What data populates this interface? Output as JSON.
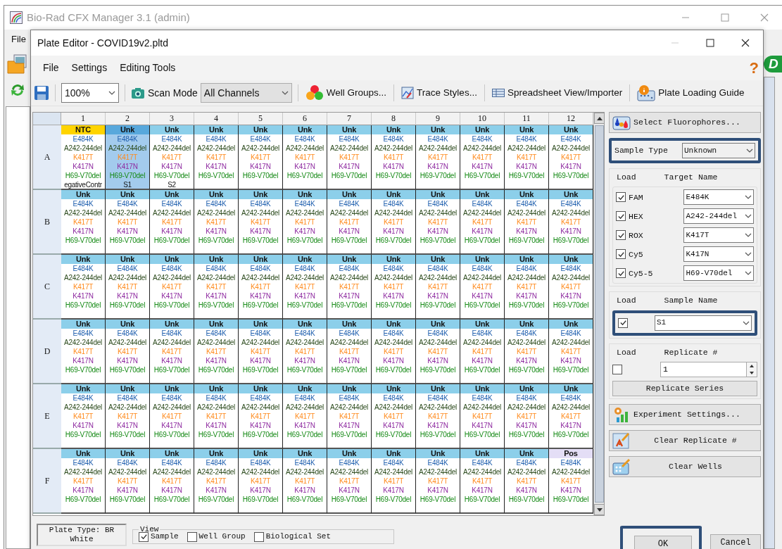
{
  "main_window": {
    "title": "Bio-Rad CFX Manager 3.1 (admin)",
    "menu": [
      "File"
    ],
    "logo_text": "D"
  },
  "dialog": {
    "title": "Plate Editor - COVID19v2.pltd",
    "menu": [
      "File",
      "Settings",
      "Editing Tools"
    ],
    "help": "?",
    "toolbar": {
      "zoom": "100%",
      "scan_mode_label": "Scan Mode",
      "scan_mode": "All Channels",
      "buttons": [
        {
          "kind": "well-groups",
          "label": "Well Groups..."
        },
        {
          "kind": "trace-styles",
          "label": "Trace Styles..."
        },
        {
          "kind": "spreadsheet",
          "label": "Spreadsheet View/Importer"
        },
        {
          "kind": "loading-guide",
          "label": "Plate Loading Guide"
        }
      ]
    }
  },
  "plate": {
    "columns": [
      "1",
      "2",
      "3",
      "4",
      "5",
      "6",
      "7",
      "8",
      "9",
      "10",
      "11",
      "12"
    ],
    "rows": [
      {
        "label": "A",
        "wells": [
          {
            "kind": "ntc",
            "type": "NTC",
            "targets": [
              "E484K",
              "A242-244del",
              "K417T",
              "K417N",
              "H69-V70del"
            ],
            "sample": "egativeContr",
            "selected": false
          },
          {
            "kind": "unknown",
            "type": "Unk",
            "targets": [
              "E484K",
              "A242-244del",
              "K417T",
              "K417N",
              "H69-V70del"
            ],
            "sample": "S1",
            "selected": true
          },
          {
            "kind": "unknown",
            "type": "Unk",
            "targets": [
              "E484K",
              "A242-244del",
              "K417T",
              "K417N",
              "H69-V70del"
            ],
            "sample": "S2",
            "selected": false
          },
          {
            "kind": "unknown",
            "type": "Unk",
            "targets": [
              "E484K",
              "A242-244del",
              "K417T",
              "K417N",
              "H69-V70del"
            ],
            "selected": false
          },
          {
            "kind": "unknown",
            "type": "Unk",
            "targets": [
              "E484K",
              "A242-244del",
              "K417T",
              "K417N",
              "H69-V70del"
            ],
            "selected": false
          },
          {
            "kind": "unknown",
            "type": "Unk",
            "targets": [
              "E484K",
              "A242-244del",
              "K417T",
              "K417N",
              "H69-V70del"
            ],
            "selected": false
          },
          {
            "kind": "unknown",
            "type": "Unk",
            "targets": [
              "E484K",
              "A242-244del",
              "K417T",
              "K417N",
              "H69-V70del"
            ],
            "selected": false
          },
          {
            "kind": "unknown",
            "type": "Unk",
            "targets": [
              "E484K",
              "A242-244del",
              "K417T",
              "K417N",
              "H69-V70del"
            ],
            "selected": false
          },
          {
            "kind": "unknown",
            "type": "Unk",
            "targets": [
              "E484K",
              "A242-244del",
              "K417T",
              "K417N",
              "H69-V70del"
            ],
            "selected": false
          },
          {
            "kind": "unknown",
            "type": "Unk",
            "targets": [
              "E484K",
              "A242-244del",
              "K417T",
              "K417N",
              "H69-V70del"
            ],
            "selected": false
          },
          {
            "kind": "unknown",
            "type": "Unk",
            "targets": [
              "E484K",
              "A242-244del",
              "K417T",
              "K417N",
              "H69-V70del"
            ],
            "selected": false
          },
          {
            "kind": "unknown",
            "type": "Unk",
            "targets": [
              "E484K",
              "A242-244del",
              "K417T",
              "K417N",
              "H69-V70del"
            ],
            "selected": false
          }
        ]
      },
      {
        "label": "B",
        "wells": [
          {
            "kind": "unknown",
            "type": "Unk",
            "targets": [
              "E484K",
              "A242-244del",
              "K417T",
              "K417N",
              "H69-V70del"
            ],
            "selected": false
          },
          {
            "kind": "unknown",
            "type": "Unk",
            "targets": [
              "E484K",
              "A242-244del",
              "K417T",
              "K417N",
              "H69-V70del"
            ],
            "selected": false
          },
          {
            "kind": "unknown",
            "type": "Unk",
            "targets": [
              "E484K",
              "A242-244del",
              "K417T",
              "K417N",
              "H69-V70del"
            ],
            "selected": false
          },
          {
            "kind": "unknown",
            "type": "Unk",
            "targets": [
              "E484K",
              "A242-244del",
              "K417T",
              "K417N",
              "H69-V70del"
            ],
            "selected": false
          },
          {
            "kind": "unknown",
            "type": "Unk",
            "targets": [
              "E484K",
              "A242-244del",
              "K417T",
              "K417N",
              "H69-V70del"
            ],
            "selected": false
          },
          {
            "kind": "unknown",
            "type": "Unk",
            "targets": [
              "E484K",
              "A242-244del",
              "K417T",
              "K417N",
              "H69-V70del"
            ],
            "selected": false
          },
          {
            "kind": "unknown",
            "type": "Unk",
            "targets": [
              "E484K",
              "A242-244del",
              "K417T",
              "K417N",
              "H69-V70del"
            ],
            "selected": false
          },
          {
            "kind": "unknown",
            "type": "Unk",
            "targets": [
              "E484K",
              "A242-244del",
              "K417T",
              "K417N",
              "H69-V70del"
            ],
            "selected": false
          },
          {
            "kind": "unknown",
            "type": "Unk",
            "targets": [
              "E484K",
              "A242-244del",
              "K417T",
              "K417N",
              "H69-V70del"
            ],
            "selected": false
          },
          {
            "kind": "unknown",
            "type": "Unk",
            "targets": [
              "E484K",
              "A242-244del",
              "K417T",
              "K417N",
              "H69-V70del"
            ],
            "selected": false
          },
          {
            "kind": "unknown",
            "type": "Unk",
            "targets": [
              "E484K",
              "A242-244del",
              "K417T",
              "K417N",
              "H69-V70del"
            ],
            "selected": false
          },
          {
            "kind": "unknown",
            "type": "Unk",
            "targets": [
              "E484K",
              "A242-244del",
              "K417T",
              "K417N",
              "H69-V70del"
            ],
            "selected": false
          }
        ]
      },
      {
        "label": "C",
        "wells": [
          {
            "kind": "unknown",
            "type": "Unk",
            "targets": [
              "E484K",
              "A242-244del",
              "K417T",
              "K417N",
              "H69-V70del"
            ],
            "selected": false
          },
          {
            "kind": "unknown",
            "type": "Unk",
            "targets": [
              "E484K",
              "A242-244del",
              "K417T",
              "K417N",
              "H69-V70del"
            ],
            "selected": false
          },
          {
            "kind": "unknown",
            "type": "Unk",
            "targets": [
              "E484K",
              "A242-244del",
              "K417T",
              "K417N",
              "H69-V70del"
            ],
            "selected": false
          },
          {
            "kind": "unknown",
            "type": "Unk",
            "targets": [
              "E484K",
              "A242-244del",
              "K417T",
              "K417N",
              "H69-V70del"
            ],
            "selected": false
          },
          {
            "kind": "unknown",
            "type": "Unk",
            "targets": [
              "E484K",
              "A242-244del",
              "K417T",
              "K417N",
              "H69-V70del"
            ],
            "selected": false
          },
          {
            "kind": "unknown",
            "type": "Unk",
            "targets": [
              "E484K",
              "A242-244del",
              "K417T",
              "K417N",
              "H69-V70del"
            ],
            "selected": false
          },
          {
            "kind": "unknown",
            "type": "Unk",
            "targets": [
              "E484K",
              "A242-244del",
              "K417T",
              "K417N",
              "H69-V70del"
            ],
            "selected": false
          },
          {
            "kind": "unknown",
            "type": "Unk",
            "targets": [
              "E484K",
              "A242-244del",
              "K417T",
              "K417N",
              "H69-V70del"
            ],
            "selected": false
          },
          {
            "kind": "unknown",
            "type": "Unk",
            "targets": [
              "E484K",
              "A242-244del",
              "K417T",
              "K417N",
              "H69-V70del"
            ],
            "selected": false
          },
          {
            "kind": "unknown",
            "type": "Unk",
            "targets": [
              "E484K",
              "A242-244del",
              "K417T",
              "K417N",
              "H69-V70del"
            ],
            "selected": false
          },
          {
            "kind": "unknown",
            "type": "Unk",
            "targets": [
              "E484K",
              "A242-244del",
              "K417T",
              "K417N",
              "H69-V70del"
            ],
            "selected": false
          },
          {
            "kind": "unknown",
            "type": "Unk",
            "targets": [
              "E484K",
              "A242-244del",
              "K417T",
              "K417N",
              "H69-V70del"
            ],
            "selected": false
          }
        ]
      },
      {
        "label": "D",
        "wells": [
          {
            "kind": "unknown",
            "type": "Unk",
            "targets": [
              "E484K",
              "A242-244del",
              "K417T",
              "K417N",
              "H69-V70del"
            ],
            "selected": false
          },
          {
            "kind": "unknown",
            "type": "Unk",
            "targets": [
              "E484K",
              "A242-244del",
              "K417T",
              "K417N",
              "H69-V70del"
            ],
            "selected": false
          },
          {
            "kind": "unknown",
            "type": "Unk",
            "targets": [
              "E484K",
              "A242-244del",
              "K417T",
              "K417N",
              "H69-V70del"
            ],
            "selected": false
          },
          {
            "kind": "unknown",
            "type": "Unk",
            "targets": [
              "E484K",
              "A242-244del",
              "K417T",
              "K417N",
              "H69-V70del"
            ],
            "selected": false
          },
          {
            "kind": "unknown",
            "type": "Unk",
            "targets": [
              "E484K",
              "A242-244del",
              "K417T",
              "K417N",
              "H69-V70del"
            ],
            "selected": false
          },
          {
            "kind": "unknown",
            "type": "Unk",
            "targets": [
              "E484K",
              "A242-244del",
              "K417T",
              "K417N",
              "H69-V70del"
            ],
            "selected": false
          },
          {
            "kind": "unknown",
            "type": "Unk",
            "targets": [
              "E484K",
              "A242-244del",
              "K417T",
              "K417N",
              "H69-V70del"
            ],
            "selected": false
          },
          {
            "kind": "unknown",
            "type": "Unk",
            "targets": [
              "E484K",
              "A242-244del",
              "K417T",
              "K417N",
              "H69-V70del"
            ],
            "selected": false
          },
          {
            "kind": "unknown",
            "type": "Unk",
            "targets": [
              "E484K",
              "A242-244del",
              "K417T",
              "K417N",
              "H69-V70del"
            ],
            "selected": false
          },
          {
            "kind": "unknown",
            "type": "Unk",
            "targets": [
              "E484K",
              "A242-244del",
              "K417T",
              "K417N",
              "H69-V70del"
            ],
            "selected": false
          },
          {
            "kind": "unknown",
            "type": "Unk",
            "targets": [
              "E484K",
              "A242-244del",
              "K417T",
              "K417N",
              "H69-V70del"
            ],
            "selected": false
          },
          {
            "kind": "unknown",
            "type": "Unk",
            "targets": [
              "E484K",
              "A242-244del",
              "K417T",
              "K417N",
              "H69-V70del"
            ],
            "selected": false
          }
        ]
      },
      {
        "label": "E",
        "wells": [
          {
            "kind": "unknown",
            "type": "Unk",
            "targets": [
              "E484K",
              "A242-244del",
              "K417T",
              "K417N",
              "H69-V70del"
            ],
            "selected": false
          },
          {
            "kind": "unknown",
            "type": "Unk",
            "targets": [
              "E484K",
              "A242-244del",
              "K417T",
              "K417N",
              "H69-V70del"
            ],
            "selected": false
          },
          {
            "kind": "unknown",
            "type": "Unk",
            "targets": [
              "E484K",
              "A242-244del",
              "K417T",
              "K417N",
              "H69-V70del"
            ],
            "selected": false
          },
          {
            "kind": "unknown",
            "type": "Unk",
            "targets": [
              "E484K",
              "A242-244del",
              "K417T",
              "K417N",
              "H69-V70del"
            ],
            "selected": false
          },
          {
            "kind": "unknown",
            "type": "Unk",
            "targets": [
              "E484K",
              "A242-244del",
              "K417T",
              "K417N",
              "H69-V70del"
            ],
            "selected": false
          },
          {
            "kind": "unknown",
            "type": "Unk",
            "targets": [
              "E484K",
              "A242-244del",
              "K417T",
              "K417N",
              "H69-V70del"
            ],
            "selected": false
          },
          {
            "kind": "unknown",
            "type": "Unk",
            "targets": [
              "E484K",
              "A242-244del",
              "K417T",
              "K417N",
              "H69-V70del"
            ],
            "selected": false
          },
          {
            "kind": "unknown",
            "type": "Unk",
            "targets": [
              "E484K",
              "A242-244del",
              "K417T",
              "K417N",
              "H69-V70del"
            ],
            "selected": false
          },
          {
            "kind": "unknown",
            "type": "Unk",
            "targets": [
              "E484K",
              "A242-244del",
              "K417T",
              "K417N",
              "H69-V70del"
            ],
            "selected": false
          },
          {
            "kind": "unknown",
            "type": "Unk",
            "targets": [
              "E484K",
              "A242-244del",
              "K417T",
              "K417N",
              "H69-V70del"
            ],
            "selected": false
          },
          {
            "kind": "unknown",
            "type": "Unk",
            "targets": [
              "E484K",
              "A242-244del",
              "K417T",
              "K417N",
              "H69-V70del"
            ],
            "selected": false
          },
          {
            "kind": "unknown",
            "type": "Unk",
            "targets": [
              "E484K",
              "A242-244del",
              "K417T",
              "K417N",
              "H69-V70del"
            ],
            "selected": false
          }
        ]
      },
      {
        "label": "F",
        "wells": [
          {
            "kind": "unknown",
            "type": "Unk",
            "targets": [
              "E484K",
              "A242-244del",
              "K417T",
              "K417N",
              "H69-V70del"
            ],
            "selected": false
          },
          {
            "kind": "unknown",
            "type": "Unk",
            "targets": [
              "E484K",
              "A242-244del",
              "K417T",
              "K417N",
              "H69-V70del"
            ],
            "selected": false
          },
          {
            "kind": "unknown",
            "type": "Unk",
            "targets": [
              "E484K",
              "A242-244del",
              "K417T",
              "K417N",
              "H69-V70del"
            ],
            "selected": false
          },
          {
            "kind": "unknown",
            "type": "Unk",
            "targets": [
              "E484K",
              "A242-244del",
              "K417T",
              "K417N",
              "H69-V70del"
            ],
            "selected": false
          },
          {
            "kind": "unknown",
            "type": "Unk",
            "targets": [
              "E484K",
              "A242-244del",
              "K417T",
              "K417N",
              "H69-V70del"
            ],
            "selected": false
          },
          {
            "kind": "unknown",
            "type": "Unk",
            "targets": [
              "E484K",
              "A242-244del",
              "K417T",
              "K417N",
              "H69-V70del"
            ],
            "selected": false
          },
          {
            "kind": "unknown",
            "type": "Unk",
            "targets": [
              "E484K",
              "A242-244del",
              "K417T",
              "K417N",
              "H69-V70del"
            ],
            "selected": false
          },
          {
            "kind": "unknown",
            "type": "Unk",
            "targets": [
              "E484K",
              "A242-244del",
              "K417T",
              "K417N",
              "H69-V70del"
            ],
            "selected": false
          },
          {
            "kind": "unknown",
            "type": "Unk",
            "targets": [
              "E484K",
              "A242-244del",
              "K417T",
              "K417N",
              "H69-V70del"
            ],
            "selected": false
          },
          {
            "kind": "unknown",
            "type": "Unk",
            "targets": [
              "E484K",
              "A242-244del",
              "K417T",
              "K417N",
              "H69-V70del"
            ],
            "selected": false
          },
          {
            "kind": "unknown",
            "type": "Unk",
            "targets": [
              "E484K",
              "A242-244del",
              "K417T",
              "K417N",
              "H69-V70del"
            ],
            "selected": false
          },
          {
            "kind": "positive",
            "type": "Pos",
            "targets": [
              "E484K",
              "A242-244del",
              "K417T",
              "K417N",
              "H69-V70del"
            ],
            "selected": false
          }
        ]
      }
    ]
  },
  "panel": {
    "select_fluorophores": "Select Fluorophores...",
    "sample_type_label": "Sample Type",
    "sample_type": "Unknown",
    "target_headers": [
      "Load",
      "Target Name"
    ],
    "targets": [
      {
        "fluor": "FAM",
        "checked": true,
        "target": "E484K",
        "color": "#1f5fae"
      },
      {
        "fluor": "HEX",
        "checked": true,
        "target": "A242-244del",
        "color": "#2b4a1c"
      },
      {
        "fluor": "ROX",
        "checked": true,
        "target": "K417T",
        "color": "#ff8a1c"
      },
      {
        "fluor": "Cy5",
        "checked": true,
        "target": "K417N",
        "color": "#8e2aa0"
      },
      {
        "fluor": "Cy5-5",
        "checked": true,
        "target": "H69-V70del",
        "color": "#168a16"
      }
    ],
    "sample_headers": [
      "Load",
      "Sample Name"
    ],
    "sample_load_checked": true,
    "sample_name": "S1",
    "replicate_headers": [
      "Load",
      "Replicate #"
    ],
    "replicate_load_checked": false,
    "replicate": "1",
    "replicate_series": "Replicate Series",
    "buttons": [
      {
        "kind": "experiment",
        "label": "Experiment Settings..."
      },
      {
        "kind": "clear-replicate",
        "label": "Clear Replicate #"
      },
      {
        "kind": "clear-wells",
        "label": "Clear Wells"
      }
    ]
  },
  "footer": {
    "plate_type": "Plate Type: BR White",
    "view_label": "View",
    "view_options": [
      {
        "label": "Sample",
        "checked": true
      },
      {
        "label": "Well Group",
        "checked": false
      },
      {
        "label": "Biological Set",
        "checked": false
      }
    ],
    "ok": "OK",
    "cancel": "Cancel"
  }
}
